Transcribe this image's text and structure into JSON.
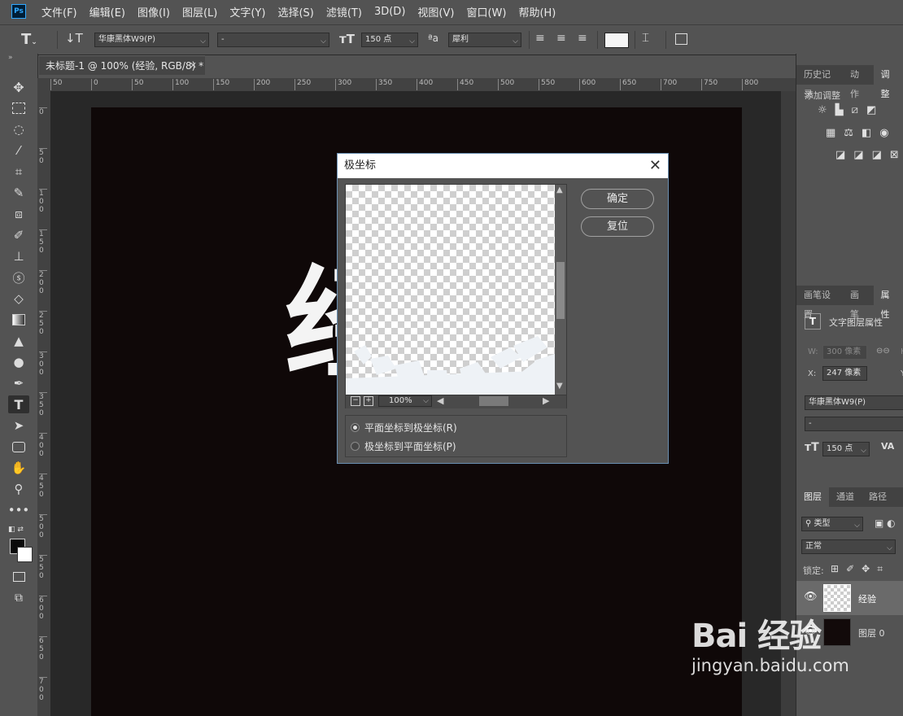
{
  "app": {
    "logo": "Ps"
  },
  "menu": [
    "文件(F)",
    "编辑(E)",
    "图像(I)",
    "图层(L)",
    "文字(Y)",
    "选择(S)",
    "滤镜(T)",
    "3D(D)",
    "视图(V)",
    "窗口(W)",
    "帮助(H)"
  ],
  "options_bar": {
    "font_family": "华康黑体W9(P)",
    "font_style": "-",
    "font_size": "150 点",
    "aa_label": "ªa",
    "antialias": "犀利"
  },
  "document": {
    "tab_title": "未标题-1 @ 100% (经验, RGB/8) *",
    "canvas_text": "经",
    "ruler_h": [
      "50",
      "0",
      "50",
      "100",
      "150",
      "200",
      "250",
      "300",
      "350",
      "400",
      "450",
      "500",
      "550",
      "600",
      "650",
      "700",
      "750",
      "800"
    ],
    "ruler_v": [
      "0",
      "5 0",
      "1 0 0",
      "1 5 0",
      "2 0 0",
      "2 5 0",
      "3 0 0",
      "3 5 0",
      "4 0 0",
      "4 5 0",
      "5 0 0",
      "5 5 0",
      "6 0 0",
      "6 5 0",
      "7 0 0"
    ]
  },
  "dialog": {
    "title": "极坐标",
    "ok_label": "确定",
    "reset_label": "复位",
    "zoom": "100%",
    "options": [
      {
        "label": "平面坐标到极坐标(R)",
        "selected": true
      },
      {
        "label": "极坐标到平面坐标(P)",
        "selected": false
      }
    ]
  },
  "panels": {
    "top_tabs": [
      "历史记录",
      "动作",
      "调整"
    ],
    "adjust_label": "添加调整",
    "mid_tabs": [
      "画笔设置",
      "画笔",
      "属性"
    ],
    "props_title": "文字图层属性",
    "w_label": "W:",
    "w_value": "300 像素",
    "h_label": "H",
    "x_label": "X:",
    "x_value": "247 像素",
    "y_label": "Y",
    "font": "华康黑体W9(P)",
    "font_style": "-",
    "size": "150 点",
    "layers_tabs": [
      "图层",
      "通道",
      "路径"
    ],
    "filter": "类型",
    "blend": "正常",
    "lock_label": "锁定:",
    "layers": [
      {
        "name": "经验",
        "thumb": "checker"
      },
      {
        "name": "图层 0",
        "thumb": "dark"
      }
    ]
  },
  "watermark": {
    "brand": "Bai 经验",
    "url": "jingyan.baidu.com"
  },
  "colors": {
    "accent": "#31a8ff",
    "canvas": "#0f0808",
    "panel": "#535353"
  }
}
